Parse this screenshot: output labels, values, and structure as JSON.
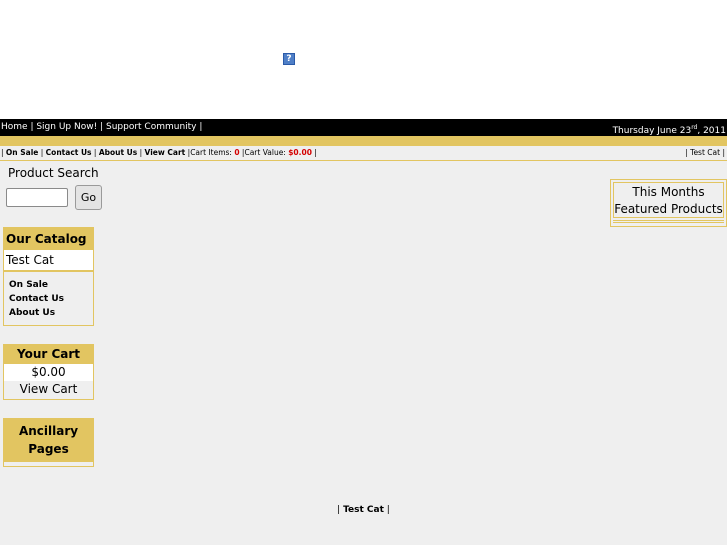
{
  "header": {
    "broken_image_glyph": "?"
  },
  "topbar": {
    "home": "Home",
    "sign_up": "Sign Up Now!",
    "support": "Support Community",
    "sep": " | ",
    "trail": " |",
    "date_prefix": "Thursday June 23",
    "date_suffix": "rd",
    "date_year": ", 2011"
  },
  "navbar": {
    "on_sale": "On Sale",
    "contact": "Contact Us",
    "about": "About Us",
    "view_cart": "View Cart",
    "cart_items_label": "Cart Items: ",
    "cart_items_value": "0",
    "cart_value_label": "Cart Value: ",
    "cart_value_value": "$0.00",
    "right_link": "Test Cat"
  },
  "search": {
    "title": "Product Search",
    "button": "Go",
    "placeholder": ""
  },
  "catalog": {
    "title": "Our Catalog",
    "category": "Test Cat",
    "links": [
      "On Sale",
      "Contact Us",
      "About Us"
    ]
  },
  "cart": {
    "title": "Your Cart",
    "value": "$0.00",
    "view": "View Cart"
  },
  "ancillary": {
    "title_line1": "Ancillary",
    "title_line2": "Pages"
  },
  "featured": {
    "line1": "This Months",
    "line2": "Featured Products"
  },
  "footer": {
    "link": "Test Cat"
  },
  "colors": {
    "gold": "#e2c561",
    "red": "#d40000",
    "topbar": "#000000",
    "background": "#efefef"
  }
}
